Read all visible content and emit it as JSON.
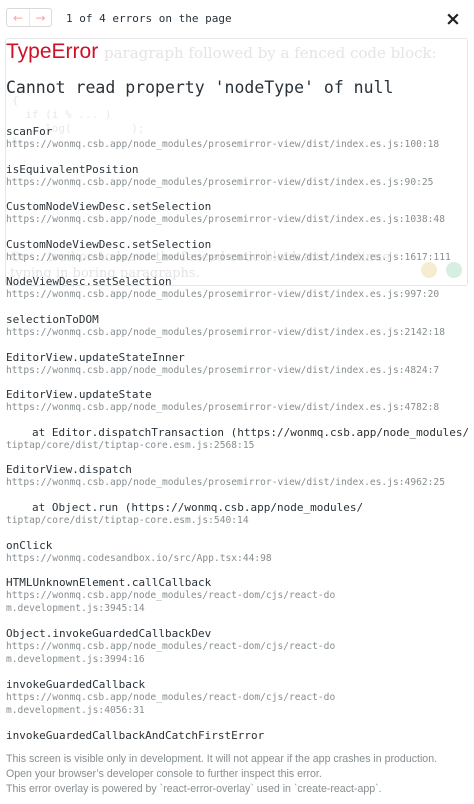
{
  "header": {
    "prev_glyph": "←",
    "next_glyph": "→",
    "error_count": "1 of 4 errors on the page",
    "close_glyph": "×"
  },
  "error": {
    "type": "TypeError",
    "message": "Cannot read property 'nodeType' of null"
  },
  "stack": [
    {
      "fn": "scanFor",
      "loc": "https://wonmq.csb.app/node_modules/prosemirror-view/dist/index.es.js:100:18"
    },
    {
      "fn": "isEquivalentPosition",
      "loc": "https://wonmq.csb.app/node_modules/prosemirror-view/dist/index.es.js:90:25"
    },
    {
      "fn": "CustomNodeViewDesc.setSelection",
      "loc": "https://wonmq.csb.app/node_modules/prosemirror-view/dist/index.es.js:1038:48"
    },
    {
      "fn": "CustomNodeViewDesc.setSelection",
      "loc": "https://wonmq.csb.app/node_modules/prosemirror-view/dist/index.es.js:1617:111"
    },
    {
      "fn": "NodeViewDesc.setSelection",
      "loc": "https://wonmq.csb.app/node_modules/prosemirror-view/dist/index.es.js:997:20"
    },
    {
      "fn": "selectionToDOM",
      "loc": "https://wonmq.csb.app/node_modules/prosemirror-view/dist/index.es.js:2142:18"
    },
    {
      "fn": "EditorView.updateStateInner",
      "loc": "https://wonmq.csb.app/node_modules/prosemirror-view/dist/index.es.js:4824:7"
    },
    {
      "fn": "EditorView.updateState",
      "loc": "https://wonmq.csb.app/node_modules/prosemirror-view/dist/index.es.js:4782:8"
    },
    {
      "fn": "at Editor.dispatchTransaction (https://wonmq.csb.app/node_modules/",
      "loc": "tiptap/core/dist/tiptap-core.esm.js:2568:15"
    },
    {
      "fn": "EditorView.dispatch",
      "loc": "https://wonmq.csb.app/node_modules/prosemirror-view/dist/index.es.js:4962:25"
    },
    {
      "fn": "at Object.run (https://wonmq.csb.app/node_modules/",
      "loc": "tiptap/core/dist/tiptap-core.esm.js:540:14"
    },
    {
      "fn": "onClick",
      "loc": "https://wonmq.codesandbox.io/src/App.tsx:44:98"
    },
    {
      "fn": "HTMLUnknownElement.callCallback",
      "loc": "https://wonmq.csb.app/node_modules/react-dom/cjs/react-dom.development.js:3945:14"
    },
    {
      "fn": "Object.invokeGuardedCallbackDev",
      "loc": "https://wonmq.csb.app/node_modules/react-dom/cjs/react-dom.development.js:3994:16"
    },
    {
      "fn": "invokeGuardedCallback",
      "loc": "https://wonmq.csb.app/node_modules/react-dom/cjs/react-dom.development.js:4056:31"
    },
    {
      "fn": "invokeGuardedCallbackAndCatchFirstError",
      "loc": ""
    }
  ],
  "footer": {
    "line1": "This screen is visible only in development. It will not appear if the app crashes in production.",
    "line2": "Open your browser’s developer console to further inspect this error.",
    "line3": "This error overlay is powered by `react-error-overlay` used in `create-react-app`."
  },
  "background_editor": {
    "line1": "paragraph followed by a fenced code block:",
    "code": "{\n  if (i % ... )\n    .log(         );\n}",
    "line2": "Or ... trail on to leave the fenced code block and continue",
    "line3": "typing in boring paragraphs."
  },
  "colors": {
    "error_red": "#ce1126",
    "text": "#293238",
    "muted": "#878e91",
    "nav_disabled": "#f2a7a7"
  }
}
